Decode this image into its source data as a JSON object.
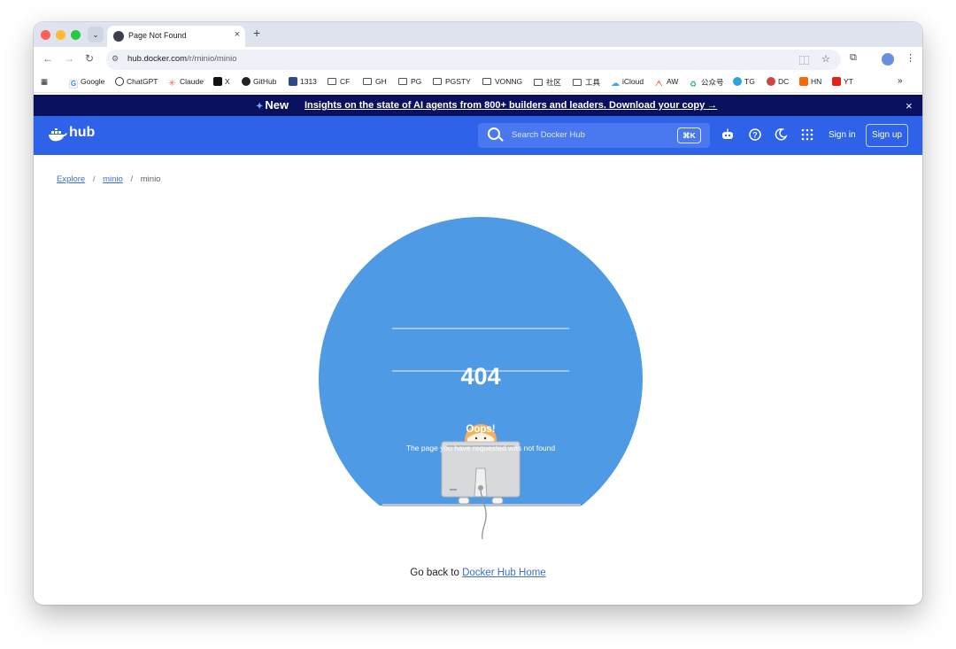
{
  "browser": {
    "tab_title": "Page Not Found",
    "new_tab": "+",
    "close_tab": "×",
    "url_host": "hub.docker.com",
    "url_path": "/r/minio/minio",
    "bookmarks": [
      "Google",
      "ChatGPT",
      "Claude",
      "X",
      "GitHub",
      "1313",
      "CF",
      "GH",
      "PG",
      "PGSTY",
      "VONNG",
      "社区",
      "工具",
      "iCloud",
      "AW",
      "公众号",
      "TG",
      "DC",
      "HN",
      "YT"
    ],
    "overflow": "»"
  },
  "promo": {
    "new_label": "New",
    "text": "Insights on the state of AI agents from 800+ builders and leaders. Download your copy →",
    "close": "×"
  },
  "header": {
    "logo_text": "hub",
    "search_placeholder": "Search Docker Hub",
    "shortcut": "⌘K",
    "sign_in": "Sign in",
    "sign_up": "Sign up"
  },
  "breadcrumb": {
    "items": [
      "Explore",
      "minio",
      "minio"
    ],
    "separator": "/"
  },
  "error": {
    "code": "404",
    "title": "Oops!",
    "message": "The page you have requested was not found"
  },
  "footer_link": {
    "prefix": "Go back to",
    "link_text": "Docker Hub Home"
  },
  "colors": {
    "header_bg": "#2e62e8",
    "promo_bg": "#09115e",
    "circle": "#4f9ae5",
    "link": "#3c6ed6"
  }
}
